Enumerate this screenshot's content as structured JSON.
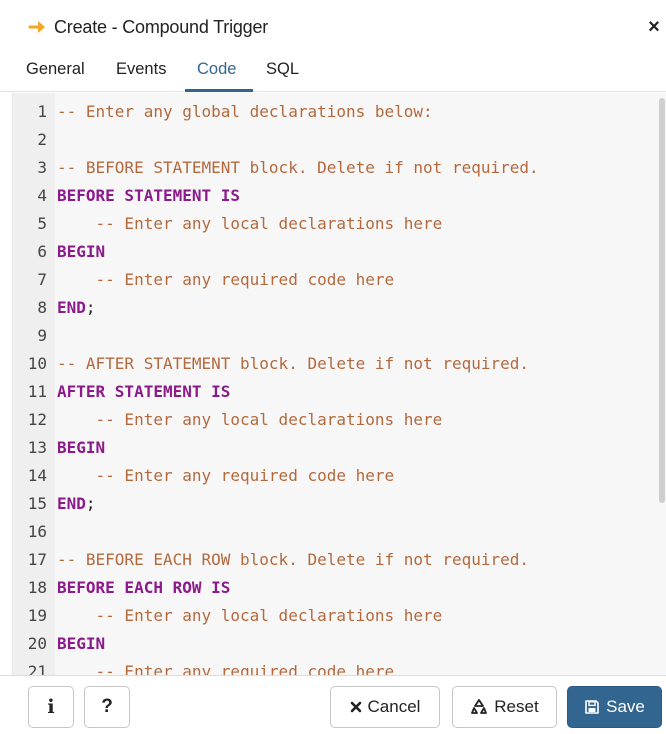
{
  "window": {
    "title": "Create - Compound Trigger",
    "close_symbol": "×",
    "title_icon": "arrow-right-icon",
    "title_icon_color": "#f5a623"
  },
  "tabs": [
    {
      "label": "General",
      "active": false
    },
    {
      "label": "Events",
      "active": false
    },
    {
      "label": "Code",
      "active": true
    },
    {
      "label": "SQL",
      "active": false
    }
  ],
  "editor": {
    "lines": [
      {
        "n": "1",
        "text": "-- Enter any global declarations below:",
        "kind": "comment",
        "indent": ""
      },
      {
        "n": "2",
        "text": "",
        "kind": "plain",
        "indent": ""
      },
      {
        "n": "3",
        "text": "-- BEFORE STATEMENT block. Delete if not required.",
        "kind": "comment",
        "indent": ""
      },
      {
        "n": "4",
        "text": "BEFORE STATEMENT IS",
        "kind": "keyword",
        "indent": ""
      },
      {
        "n": "5",
        "text": "-- Enter any local declarations here",
        "kind": "comment",
        "indent": "    "
      },
      {
        "n": "6",
        "text": "BEGIN",
        "kind": "keyword",
        "indent": ""
      },
      {
        "n": "7",
        "text": "-- Enter any required code here",
        "kind": "comment",
        "indent": "    "
      },
      {
        "n": "8",
        "text": "END",
        "kind": "keyword",
        "indent": "",
        "suffix": ";"
      },
      {
        "n": "9",
        "text": "",
        "kind": "plain",
        "indent": ""
      },
      {
        "n": "10",
        "text": "-- AFTER STATEMENT block. Delete if not required.",
        "kind": "comment",
        "indent": ""
      },
      {
        "n": "11",
        "text": "AFTER STATEMENT IS",
        "kind": "keyword",
        "indent": ""
      },
      {
        "n": "12",
        "text": "-- Enter any local declarations here",
        "kind": "comment",
        "indent": "    "
      },
      {
        "n": "13",
        "text": "BEGIN",
        "kind": "keyword",
        "indent": ""
      },
      {
        "n": "14",
        "text": "-- Enter any required code here",
        "kind": "comment",
        "indent": "    "
      },
      {
        "n": "15",
        "text": "END",
        "kind": "keyword",
        "indent": "",
        "suffix": ";"
      },
      {
        "n": "16",
        "text": "",
        "kind": "plain",
        "indent": ""
      },
      {
        "n": "17",
        "text": "-- BEFORE EACH ROW block. Delete if not required.",
        "kind": "comment",
        "indent": ""
      },
      {
        "n": "18",
        "text": "BEFORE EACH ROW IS",
        "kind": "keyword",
        "indent": ""
      },
      {
        "n": "19",
        "text": "-- Enter any local declarations here",
        "kind": "comment",
        "indent": "    "
      },
      {
        "n": "20",
        "text": "BEGIN",
        "kind": "keyword",
        "indent": ""
      },
      {
        "n": "21",
        "text": "-- Enter any required code here",
        "kind": "comment",
        "indent": "    "
      }
    ],
    "colors": {
      "comment": "#b4693d",
      "keyword": "#8b1a8b"
    }
  },
  "footer": {
    "info_label": "i",
    "help_label": "?",
    "cancel_label": "Cancel",
    "reset_label": "Reset",
    "save_label": "Save",
    "accent": "#326690"
  }
}
